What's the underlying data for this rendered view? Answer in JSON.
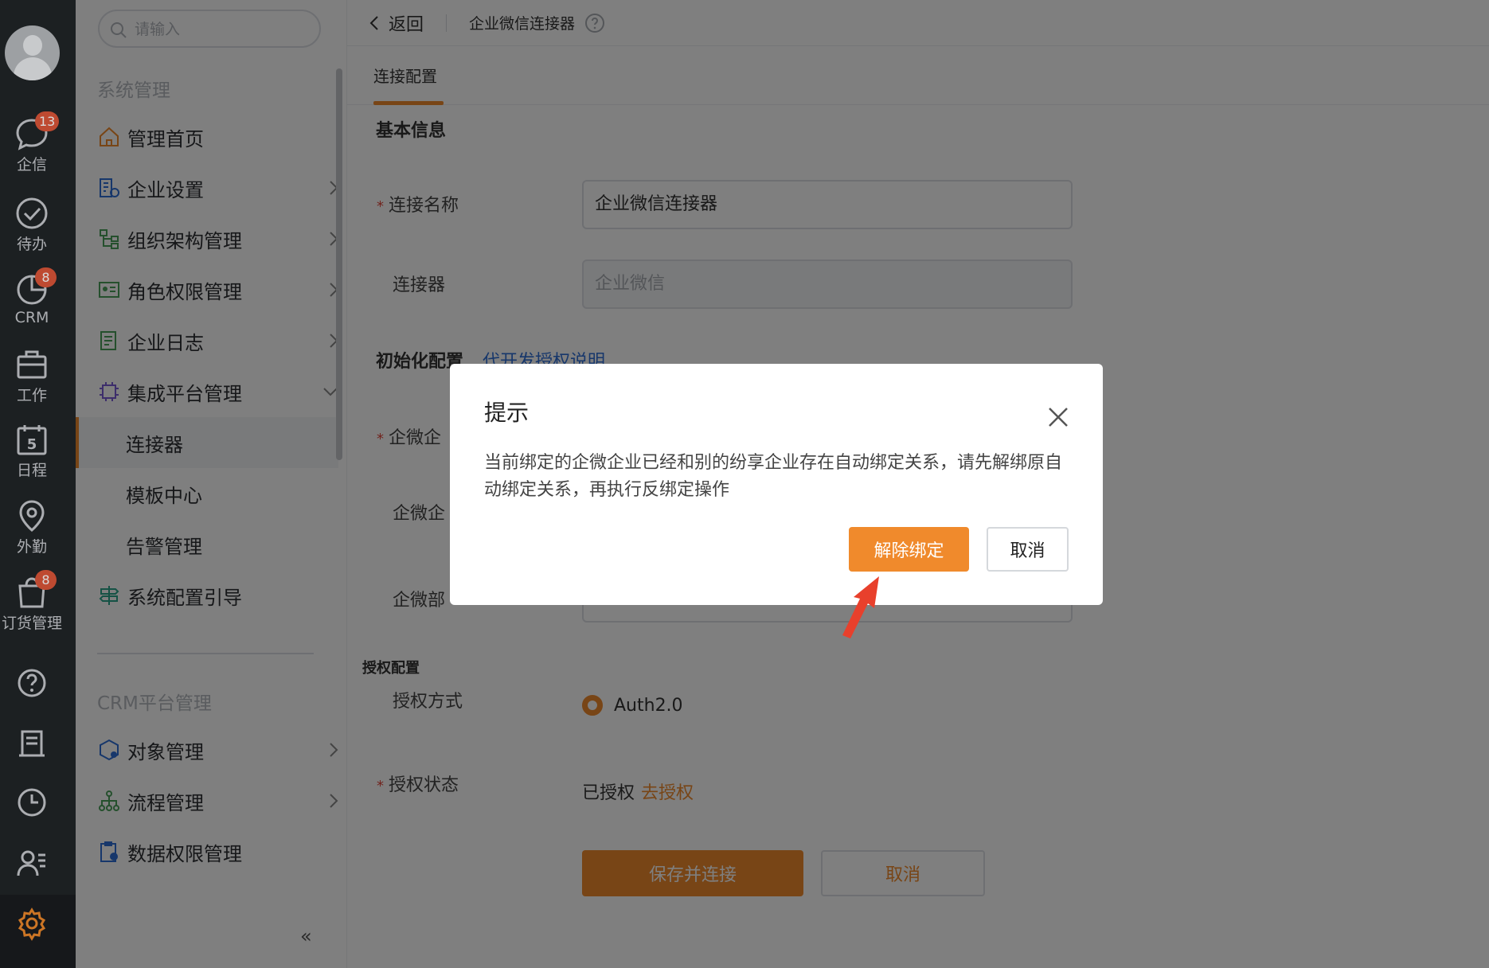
{
  "rail": {
    "items": [
      {
        "label": "企信",
        "badge": "13",
        "icon": "chat-bubble-icon"
      },
      {
        "label": "待办",
        "badge": "",
        "icon": "check-circle-icon"
      },
      {
        "label": "CRM",
        "badge": "8",
        "icon": "pie-chart-icon"
      },
      {
        "label": "工作",
        "badge": "",
        "icon": "briefcase-icon"
      },
      {
        "label": "日程",
        "badge": "",
        "icon": "calendar-icon",
        "day": "5"
      },
      {
        "label": "外勤",
        "badge": "",
        "icon": "location-pin-icon"
      },
      {
        "label": "订货管理",
        "badge": "8",
        "icon": "shopping-bag-icon"
      }
    ],
    "bottom_icons": [
      "help-icon",
      "document-icon",
      "clock-icon",
      "contacts-icon",
      "settings-gear-icon"
    ]
  },
  "sidebar": {
    "search_placeholder": "请输入",
    "section1": "系统管理",
    "items": [
      {
        "label": "管理首页"
      },
      {
        "label": "企业设置"
      },
      {
        "label": "组织架构管理"
      },
      {
        "label": "角色权限管理"
      },
      {
        "label": "企业日志"
      },
      {
        "label": "集成平台管理"
      },
      {
        "label": "连接器"
      },
      {
        "label": "模板中心"
      },
      {
        "label": "告警管理"
      },
      {
        "label": "系统配置引导"
      }
    ],
    "section2": "CRM平台管理",
    "items2": [
      {
        "label": "对象管理"
      },
      {
        "label": "流程管理"
      },
      {
        "label": "数据权限管理"
      }
    ],
    "collapse_label": "«"
  },
  "topbar": {
    "back_label": "返回",
    "crumb": "企业微信连接器"
  },
  "tabs": {
    "active": "连接配置"
  },
  "form": {
    "basic_title": "基本信息",
    "name_label": "连接名称",
    "name_value": "企业微信连接器",
    "connector_label": "连接器",
    "connector_placeholder": "企业微信",
    "init_title": "初始化配置",
    "init_link": "代开发授权说明",
    "corp_id_label": "企微企",
    "corp_secret_label": "企微企",
    "dept_label": "企微部",
    "auth_title": "授权配置",
    "auth_mode_label": "授权方式",
    "auth_mode_value": "Auth2.0",
    "auth_state_label": "授权状态",
    "auth_state_value": "已授权",
    "auth_state_link": "去授权",
    "save_label": "保存并连接",
    "cancel_label": "取消"
  },
  "dialog": {
    "title": "提示",
    "message": "当前绑定的企微企业已经和别的纷享企业存在自动绑定关系，请先解绑原自动绑定关系，再执行反绑定操作",
    "ok_label": "解除绑定",
    "cancel_label": "取消"
  },
  "colors": {
    "accent": "#f08a2c",
    "link": "#2f6ed6",
    "badge": "#e0573a",
    "rail": "#222629",
    "annotation_arrow": "#e8402c"
  }
}
